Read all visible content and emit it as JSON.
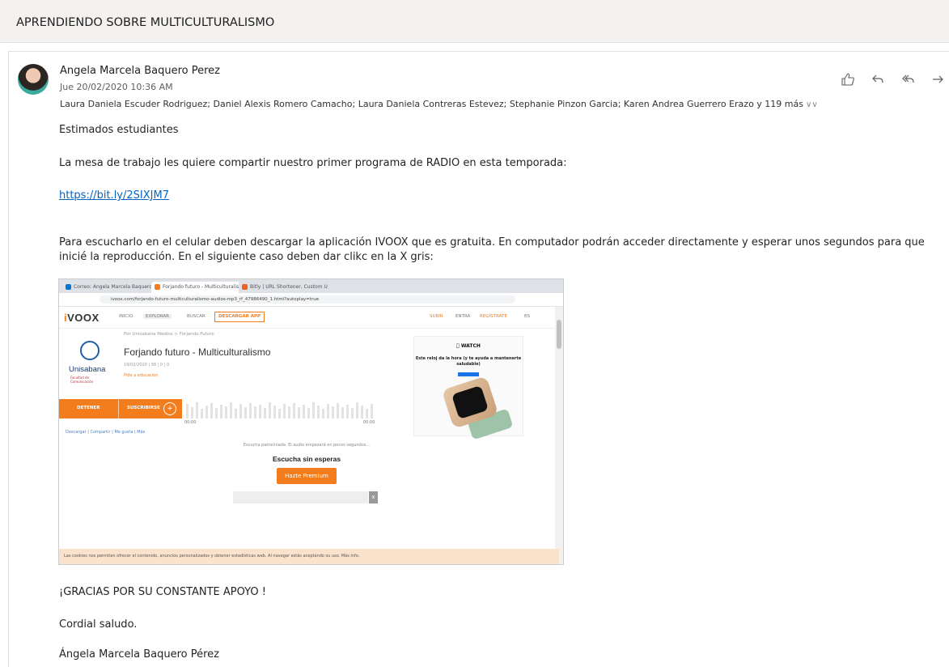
{
  "subject": "APRENDIENDO SOBRE MULTICULTURALISMO",
  "sender": {
    "name": "Angela Marcela Baquero Perez",
    "date": "Jue 20/02/2020 10:36 AM",
    "recipients": "Laura Daniela Escuder Rodriguez; Daniel Alexis Romero Camacho; Laura Daniela Contreras Estevez; Stephanie Pinzon Garcia; Karen Andrea Guerrero Erazo y 119 más"
  },
  "actions": {
    "like": "👍",
    "reply": "↶",
    "reply_all": "↺",
    "forward": "→"
  },
  "body": {
    "greeting": "Estimados estudiantes",
    "intro": "La mesa de trabajo les quiere compartir nuestro primer programa de RADIO en esta temporada:",
    "link": "https://bit.ly/2SIXJM7",
    "instructions": "Para escucharlo en el celular deben descargar la aplicación IVOOX que es gratuita. En computador podrán acceder directamente y esperar unos segundos para que inicié la reproducción.  En el siguiente caso deben dar clikc en la X gris:",
    "thanks": "¡GRACIAS POR SU CONSTANTE APOYO !",
    "closing": "Cordial saludo.",
    "signature": "Ángela Marcela Baquero Pérez"
  },
  "embedded": {
    "tabs": [
      "Correo: Angela Marcela Baquero",
      "Forjando futuro - Multiculturalis",
      "Bitly | URL Shortener, Custom U"
    ],
    "url": "ivoox.com/forjando-futuro-multiculturalismo-audios-mp3_rf_47986490_1.html?autoplay=true",
    "logo_a": "i",
    "logo_b": "VOOX",
    "nav": [
      "INICIO",
      "EXPLORAR",
      "BUSCAR"
    ],
    "download_app": "DESCARGAR APP",
    "right_nav": [
      "SUBIR",
      "ENTRA",
      "REGÍSTRATE",
      "ES"
    ],
    "breadcrumb": "Por Unisabana Medios  >  Forjando Futuro",
    "episode_title": "Forjando futuro - Multiculturalismo",
    "meta": "19/02/2020   |   38   |   0   |   0",
    "meta2": "Pide a educación",
    "uni_name": "Unisabana",
    "uni_sub": "Facultad de Comunicación",
    "stop": "DETENER",
    "subscribe": "SUSCRIBIRSE",
    "plus": "+",
    "time_start": "00:00",
    "time_end": "00:00",
    "share_row": "Descargar   |   Compartir   |   Me gusta   |   Más",
    "ad_brand": "WATCH",
    "ad_text": "Este reloj da la hora (y te ayuda a mantenerte saludable)",
    "sponsor_msg": "Escucha patrocinada. El audio empezará en pocos segundos...",
    "listen_no_wait": "Escucha sin esperas",
    "premium": "Hazte Premium",
    "close_x": "x",
    "cookies": "Las cookies nos permiten ofrecer el contenido, anuncios personalizados y obtener estadísticas web. Al navegar estás aceptando su uso. Más info."
  }
}
